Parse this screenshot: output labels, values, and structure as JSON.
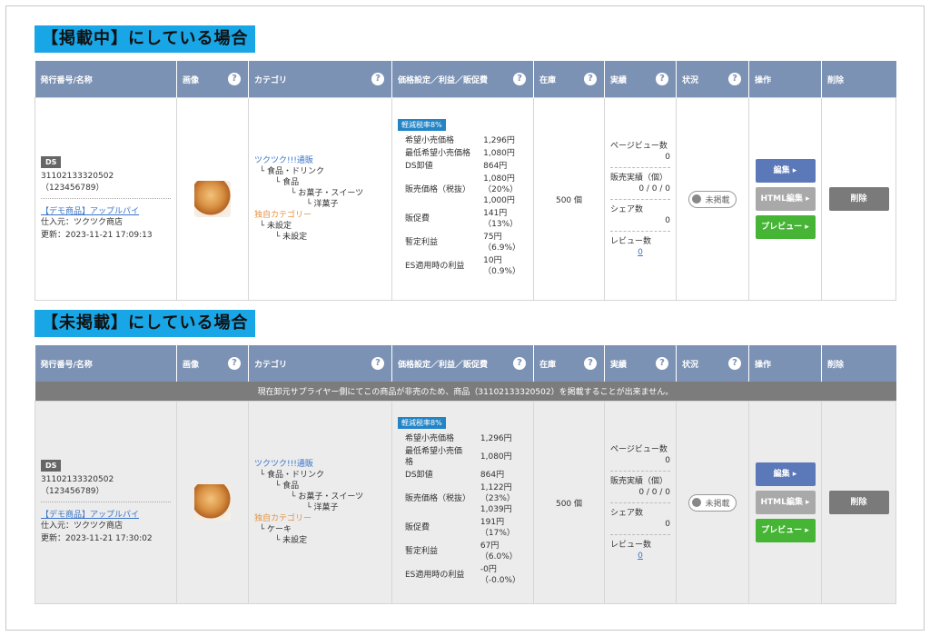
{
  "sections": [
    {
      "heading": "【掲載中】にしている場合",
      "notice": "",
      "row": {
        "ds": "DS",
        "id": "31102133320502 （123456789）",
        "name": "【デモ商品】アップルパイ",
        "supplier": "仕入元：ツクツク商店",
        "updated": "更新：2023-11-21 17:09:13",
        "category_lines": [
          {
            "text": "ツクツク!!!通販",
            "cls": "blue"
          },
          {
            "text": "  └ 食品・ドリンク",
            "cls": ""
          },
          {
            "text": "        └ 食品",
            "cls": ""
          },
          {
            "text": "              └ お菓子・スイーツ",
            "cls": ""
          },
          {
            "text": "                    └ 洋菓子",
            "cls": ""
          },
          {
            "text": "独自カテゴリー",
            "cls": "orange"
          },
          {
            "text": "  └ 未設定",
            "cls": ""
          },
          {
            "text": "        └ 未設定",
            "cls": ""
          }
        ],
        "tax_badge": "軽減税率8%",
        "prices": [
          {
            "k": "希望小売価格",
            "v": "1,296円"
          },
          {
            "k": "最低希望小売価格",
            "v": "1,080円"
          },
          {
            "k": "DS卸値",
            "v": "864円"
          },
          {
            "k": "販売価格（税抜）",
            "v": "1,080円（20%）\n1,000円"
          },
          {
            "k": "販促費",
            "v": "141円（13%）"
          },
          {
            "k": "暫定利益",
            "v": "75円（6.9%）"
          },
          {
            "k": "ES適用時の利益",
            "v": "10円（0.9%）"
          }
        ],
        "stock": "500 個",
        "perf": {
          "pv_label": "ページビュー数",
          "pv": "0",
          "sales_label": "販売実績（個）",
          "sales": "0 / 0 / 0",
          "share_label": "シェア数",
          "share": "0",
          "review_label": "レビュー数",
          "review": "0"
        },
        "status": "未掲載",
        "buttons": {
          "edit": "編集 ▸",
          "html": "HTML編集 ▸",
          "preview": "プレビュー ▸",
          "delete": "削除"
        }
      }
    },
    {
      "heading": "【未掲載】にしている場合",
      "notice": "現在卸元サプライヤー側にてこの商品が非売のため、商品（31102133320502）を掲載することが出来ません。",
      "row": {
        "ds": "DS",
        "id": "31102133320502 （123456789）",
        "name": "【デモ商品】アップルパイ",
        "supplier": "仕入元：ツクツク商店",
        "updated": "更新：2023-11-21 17:30:02",
        "category_lines": [
          {
            "text": "ツクツク!!!通販",
            "cls": "blue"
          },
          {
            "text": "  └ 食品・ドリンク",
            "cls": ""
          },
          {
            "text": "        └ 食品",
            "cls": ""
          },
          {
            "text": "              └ お菓子・スイーツ",
            "cls": ""
          },
          {
            "text": "                    └ 洋菓子",
            "cls": ""
          },
          {
            "text": "独自カテゴリー",
            "cls": "orange"
          },
          {
            "text": "  └ ケーキ",
            "cls": ""
          },
          {
            "text": "        └ 未設定",
            "cls": ""
          }
        ],
        "tax_badge": "軽減税率8%",
        "prices": [
          {
            "k": "希望小売価格",
            "v": "1,296円"
          },
          {
            "k": "最低希望小売価格",
            "v": "1,080円"
          },
          {
            "k": "DS卸値",
            "v": "864円"
          },
          {
            "k": "販売価格（税抜）",
            "v": "1,122円（23%）\n1,039円"
          },
          {
            "k": "販促費",
            "v": "191円（17%）"
          },
          {
            "k": "暫定利益",
            "v": "67円（6.0%）"
          },
          {
            "k": "ES適用時の利益",
            "v": "-0円（-0.0%）"
          }
        ],
        "stock": "500 個",
        "perf": {
          "pv_label": "ページビュー数",
          "pv": "0",
          "sales_label": "販売実績（個）",
          "sales": "0 / 0 / 0",
          "share_label": "シェア数",
          "share": "0",
          "review_label": "レビュー数",
          "review": "0"
        },
        "status": "未掲載",
        "buttons": {
          "edit": "編集 ▸",
          "html": "HTML編集 ▸",
          "preview": "プレビュー ▸",
          "delete": "削除"
        }
      }
    }
  ],
  "columns": [
    "発行番号/名称",
    "画像",
    "カテゴリ",
    "価格設定／利益／販促費",
    "在庫",
    "実績",
    "状況",
    "操作",
    "削除"
  ],
  "help_glyph": "?",
  "colors": {
    "header_bg": "#7c92b5",
    "heading_bg": "#19a6e6",
    "edit": "#5b78b8",
    "preview": "#46b536",
    "delete": "#7a7a7a"
  }
}
